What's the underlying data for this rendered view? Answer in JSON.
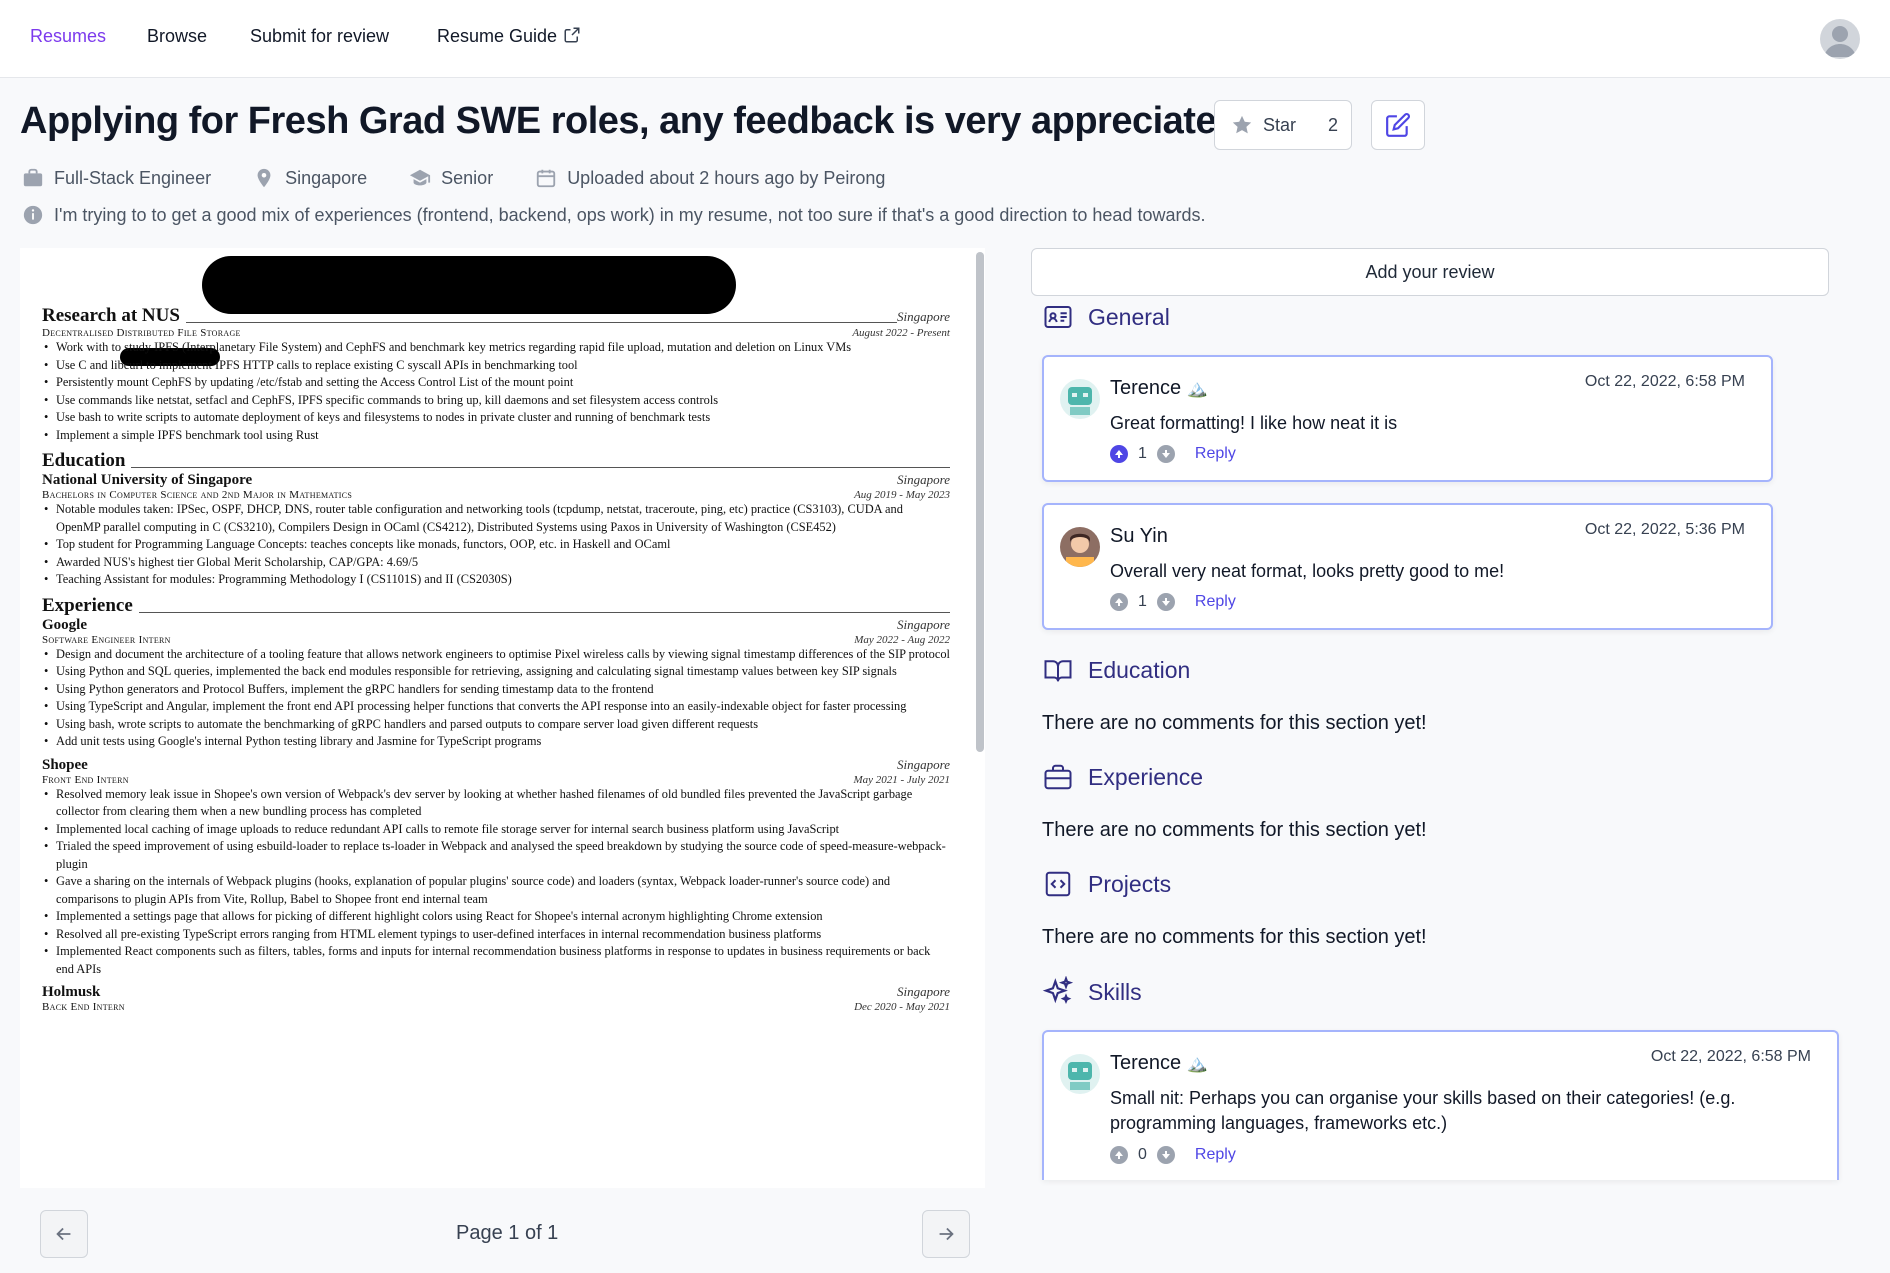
{
  "nav": {
    "links": [
      "Resumes",
      "Browse",
      "Submit for review",
      "Resume Guide"
    ],
    "avatar_icon": "user-avatar"
  },
  "header": {
    "title": "Applying for Fresh Grad SWE roles, any feedback is very appreciated!",
    "star_label": "Star",
    "star_count": "2",
    "role": "Full-Stack Engineer",
    "location": "Singapore",
    "experience": "Senior",
    "uploaded": "Uploaded about 2 hours ago by Peirong",
    "additional_info": "I'm trying to to get a good mix of experiences (frontend, backend, ops work) in my resume, not too sure if that's a good direction to head towards."
  },
  "resume": {
    "research": {
      "section": "Research at NUS",
      "location": "Singapore",
      "subtitle": "Decentralised Distributed File Storage",
      "date": "August 2022 - Present",
      "bullets": [
        "Work with              to study IPFS (Interplanetary File System) and CephFS and benchmark key metrics regarding rapid file upload, mutation and deletion on Linux VMs",
        "Use C and libcurl to implement IPFS HTTP calls to replace existing C syscall APIs in benchmarking tool",
        "Persistently mount CephFS by updating /etc/fstab and setting the Access Control List of the mount point",
        "Use commands like netstat, setfacl and CephFS, IPFS specific commands to bring up, kill daemons and set filesystem access controls",
        "Use bash to write scripts to automate deployment of keys and filesystems to nodes in private cluster and running of benchmark tests",
        "Implement a simple IPFS benchmark tool using Rust"
      ]
    },
    "education": {
      "section": "Education",
      "org": "National University of Singapore",
      "location": "Singapore",
      "subtitle": "Bachelors in Computer Science and 2nd Major in Mathematics",
      "date": "Aug 2019 - May 2023",
      "bullets": [
        "Notable modules taken: IPSec, OSPF, DHCP, DNS, router table configuration and networking tools (tcpdump, netstat, traceroute, ping, etc) practice (CS3103), CUDA and OpenMP parallel computing in C (CS3210), Compilers Design in OCaml (CS4212), Distributed Systems using Paxos in University of Washington (CSE452)",
        "Top student for Programming Language Concepts: teaches concepts like monads, functors, OOP, etc. in Haskell and OCaml",
        "Awarded NUS's highest tier Global Merit Scholarship, CAP/GPA: 4.69/5",
        "Teaching Assistant for modules: Programming Methodology I (CS1101S) and II (CS2030S)"
      ]
    },
    "experience": {
      "section": "Experience",
      "google": {
        "org": "Google",
        "location": "Singapore",
        "subtitle": "Software Engineer Intern",
        "date": "May 2022 - Aug 2022",
        "bullets": [
          "Design and document the architecture of a tooling feature that allows network engineers to optimise Pixel wireless calls by viewing signal timestamp differences of the SIP protocol",
          "Using Python and SQL queries, implemented the back end modules responsible for retrieving, assigning and calculating signal timestamp values between key SIP signals",
          "Using Python generators and Protocol Buffers, implement the gRPC handlers for sending timestamp data to the frontend",
          "Using TypeScript and Angular, implement the front end API processing helper functions that converts the API response into an easily-indexable object for faster processing",
          "Using bash, wrote scripts to automate the benchmarking of gRPC handlers and parsed outputs to compare server load given different requests",
          "Add unit tests using Google's internal Python testing library and Jasmine for TypeScript programs"
        ]
      },
      "shopee": {
        "org": "Shopee",
        "location": "Singapore",
        "subtitle": "Front End Intern",
        "date": "May 2021 - July 2021",
        "bullets": [
          "Resolved memory leak issue in Shopee's own version of Webpack's dev server by looking at whether hashed filenames of old bundled files prevented the JavaScript garbage collector from clearing them when a new bundling process has completed",
          "Implemented local caching of image uploads to reduce redundant API calls to remote file storage server for internal search business platform using JavaScript",
          "Trialed the speed improvement of using esbuild-loader to replace ts-loader in Webpack and analysed the speed breakdown by studying the source code of speed-measure-webpack-plugin",
          "Gave a sharing on the internals of Webpack plugins (hooks, explanation of popular plugins' source code) and loaders (syntax, Webpack loader-runner's source code) and comparisons to plugin APIs from Vite, Rollup, Babel to Shopee front end internal team",
          "Implemented a settings page that allows for picking of different highlight colors using React for Shopee's internal acronym highlighting Chrome extension",
          "Resolved all pre-existing TypeScript errors ranging from HTML element typings to user-defined interfaces in internal recommendation business platforms",
          "Implemented React components such as filters, tables, forms and inputs for internal recommendation business platforms in response to updates in business requirements or back end APIs"
        ]
      },
      "holmusk": {
        "org": "Holmusk",
        "location": "Singapore",
        "subtitle": "Back End Intern",
        "date": "Dec 2020 - May 2021"
      }
    }
  },
  "pager": {
    "text": "Page 1 of 1"
  },
  "reviews": {
    "add_review_label": "Add your review",
    "empty_text": "There are no comments for this section yet!",
    "sections": {
      "general": "General",
      "education": "Education",
      "experience": "Experience",
      "projects": "Projects",
      "skills": "Skills"
    },
    "comments": [
      {
        "author": "Terence",
        "badge": "🏔️",
        "date": "Oct 22, 2022, 6:58 PM",
        "text": "Great formatting! I like how neat it is",
        "votes": "1",
        "reply": "Reply"
      },
      {
        "author": "Su Yin",
        "badge": "",
        "date": "Oct 22, 2022, 5:36 PM",
        "text": "Overall very neat format, looks pretty good to me!",
        "votes": "1",
        "reply": "Reply"
      },
      {
        "author": "Terence",
        "badge": "🏔️",
        "date": "Oct 22, 2022, 6:58 PM",
        "text": "Small nit: Perhaps you can organise your skills based on their categories! (e.g. programming languages, frameworks etc.)",
        "votes": "0",
        "reply": "Reply"
      }
    ]
  },
  "colors": {
    "accent": "#7c3aed",
    "section_heading": "#312e81",
    "card_border": "#a5b4fc",
    "link": "#4f46e5"
  }
}
